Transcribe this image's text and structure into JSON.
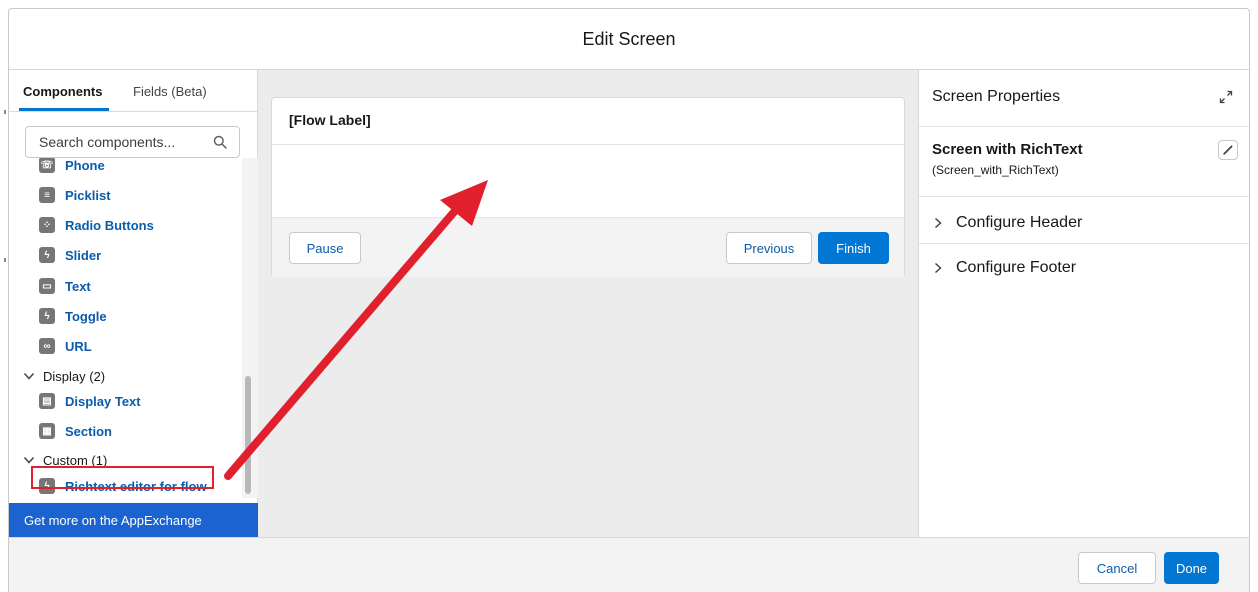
{
  "dialog": {
    "title": "Edit Screen"
  },
  "tabs": [
    {
      "label": "Components"
    },
    {
      "label": "Fields (Beta)"
    }
  ],
  "search": {
    "placeholder": "Search components..."
  },
  "components": [
    {
      "label": "Phone",
      "icon": "phone-icon"
    },
    {
      "label": "Picklist",
      "icon": "picklist-icon"
    },
    {
      "label": "Radio Buttons",
      "icon": "radio-buttons-icon"
    },
    {
      "label": "Slider",
      "icon": "lightning-bolt-icon"
    },
    {
      "label": "Text",
      "icon": "text-field-icon"
    },
    {
      "label": "Toggle",
      "icon": "lightning-bolt-icon"
    },
    {
      "label": "URL",
      "icon": "link-icon"
    }
  ],
  "sections": {
    "display": {
      "label": "Display (2)",
      "items": [
        {
          "label": "Display Text",
          "icon": "display-text-icon"
        },
        {
          "label": "Section",
          "icon": "section-icon"
        }
      ]
    },
    "custom": {
      "label": "Custom (1)",
      "items": [
        {
          "label": "Richtext editor for flow",
          "icon": "lightning-bolt-icon"
        }
      ]
    }
  },
  "appexchange": {
    "label": "Get more on the AppExchange"
  },
  "canvas": {
    "flow_label": "[Flow Label]",
    "pause_label": "Pause",
    "previous_label": "Previous",
    "finish_label": "Finish"
  },
  "properties": {
    "title": "Screen Properties",
    "screen_name": "Screen with RichText",
    "api_name": "(Screen_with_RichText)",
    "accordions": [
      {
        "label": "Configure Header"
      },
      {
        "label": "Configure Footer"
      }
    ]
  },
  "footer": {
    "cancel_label": "Cancel",
    "done_label": "Done"
  },
  "colors": {
    "brand": "#0176d3",
    "link": "#0b5cab",
    "appexchange_bar": "#1b63cf",
    "annotation": "#e0212d"
  }
}
